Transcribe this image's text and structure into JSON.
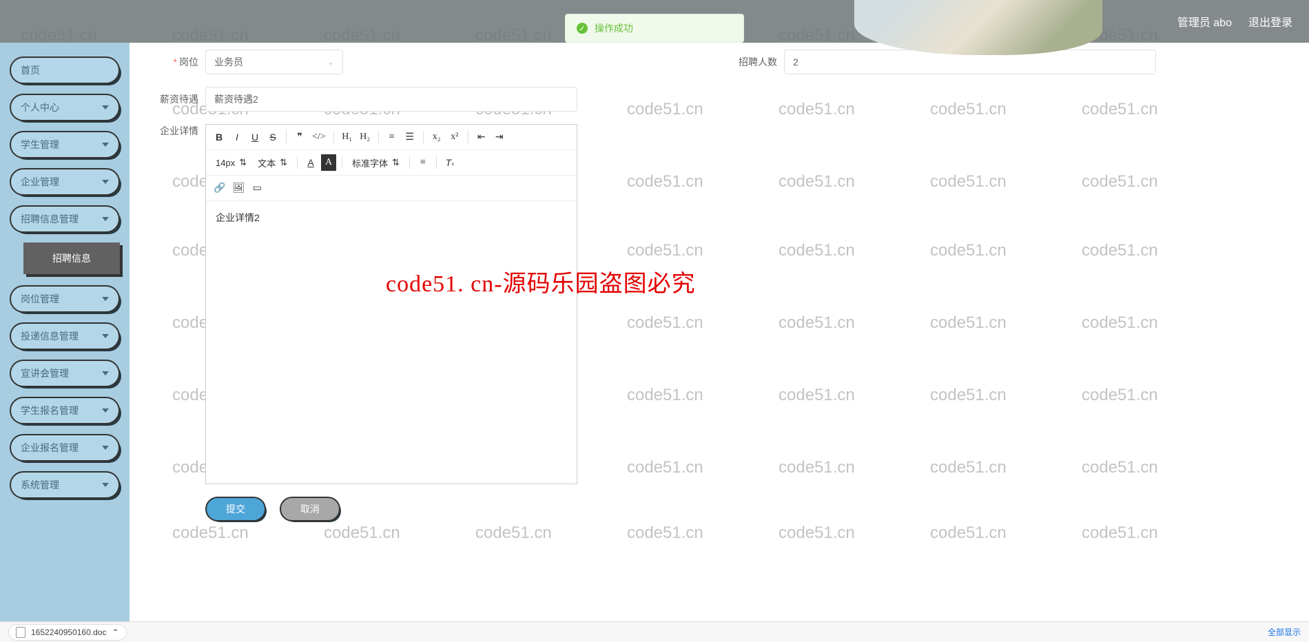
{
  "header": {
    "user_label": "管理员 abo",
    "logout": "退出登录"
  },
  "toast": {
    "text": "操作成功"
  },
  "sidebar": {
    "items": [
      {
        "label": "首页",
        "expandable": false
      },
      {
        "label": "个人中心",
        "expandable": true
      },
      {
        "label": "学生管理",
        "expandable": true
      },
      {
        "label": "企业管理",
        "expandable": true
      },
      {
        "label": "招聘信息管理",
        "expandable": true
      },
      {
        "label": "岗位管理",
        "expandable": true
      },
      {
        "label": "投递信息管理",
        "expandable": true
      },
      {
        "label": "宣讲会管理",
        "expandable": true
      },
      {
        "label": "学生报名管理",
        "expandable": true
      },
      {
        "label": "企业报名管理",
        "expandable": true
      },
      {
        "label": "系统管理",
        "expandable": true
      }
    ],
    "sub_item": "招聘信息"
  },
  "form": {
    "position_label": "岗位",
    "position_value": "业务员",
    "headcount_label": "招聘人数",
    "headcount_value": "2",
    "salary_label": "薪资待遇",
    "salary_value": "薪资待遇2",
    "detail_label": "企业详情",
    "detail_body": "企业详情2",
    "submit": "提交",
    "cancel": "取消"
  },
  "editor_toolbar": {
    "fontsize": "14px",
    "paragraph": "文本",
    "fontfamily": "标准字体"
  },
  "download": {
    "filename": "1652240950160.doc",
    "show_all": "全部显示"
  },
  "watermark": {
    "text": "code51.cn",
    "red_text": "code51. cn-源码乐园盗图必究"
  }
}
